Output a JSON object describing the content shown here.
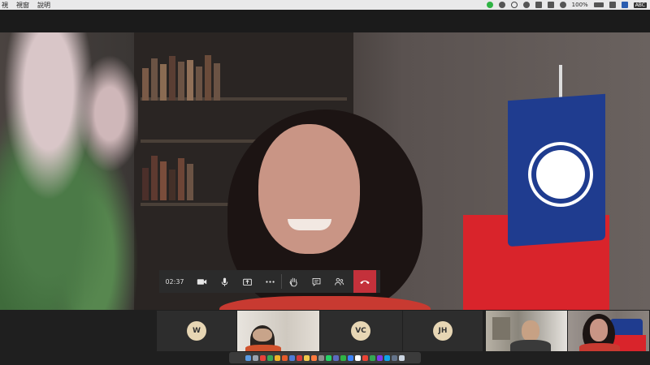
{
  "menubar": {
    "items": [
      "視",
      "視窗",
      "說明"
    ],
    "battery": "100%",
    "input_method": "ABC"
  },
  "call": {
    "timer": "02:37"
  },
  "participants": [
    {
      "initials": "W"
    },
    {
      "initials": "VC"
    },
    {
      "initials": "JH"
    }
  ],
  "colors": {
    "hangup": "#c4313b",
    "avatar_bg": "#e7d6b4",
    "control_bar": "#2b2b2b"
  },
  "icons": {
    "controls": [
      "video-camera-icon",
      "microphone-icon",
      "share-screen-icon",
      "more-options-icon",
      "raise-hand-icon",
      "chat-icon",
      "participants-icon",
      "hang-up-icon"
    ]
  }
}
